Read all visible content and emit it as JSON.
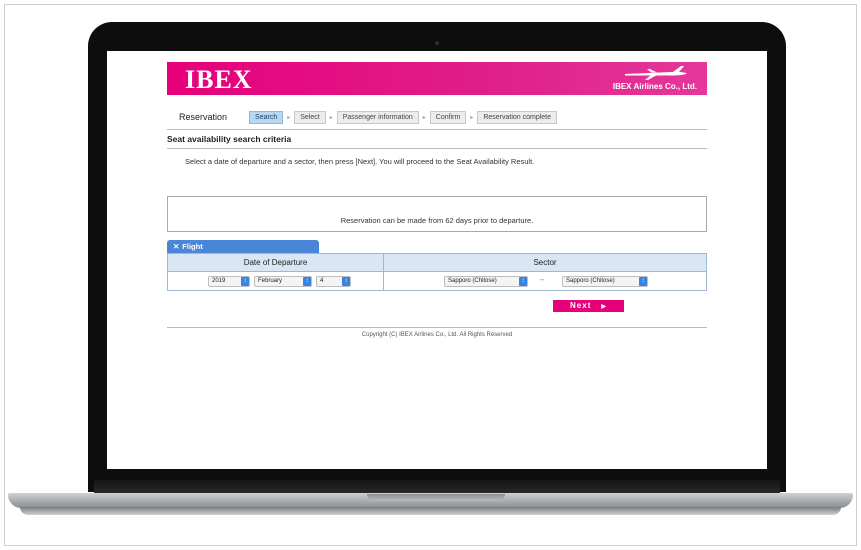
{
  "brand": {
    "logo": "IBEX",
    "company": "IBEX Airlines Co., Ltd.",
    "banner_color": "#e6007a"
  },
  "steps": {
    "label": "Reservation",
    "items": [
      {
        "label": "Search",
        "active": true
      },
      {
        "label": "Select",
        "active": false
      },
      {
        "label": "Passenger information",
        "active": false
      },
      {
        "label": "Confirm",
        "active": false
      },
      {
        "label": "Reservation complete",
        "active": false
      }
    ],
    "separator": "▸"
  },
  "section": {
    "title": "Seat availability search criteria",
    "instruction": "Select a date of departure and a sector, then press [Next]. You will proceed to the Seat Availability Result."
  },
  "notice": {
    "text": "Reservation can be made from 62 days prior to departure."
  },
  "flight": {
    "tab_label": "Flight",
    "tab_icon": "✕",
    "headers": {
      "date": "Date of Departure",
      "sector": "Sector"
    },
    "date": {
      "year": "2019",
      "month": "February",
      "day": "4"
    },
    "sector": {
      "from": "Sapporo (Chitose)",
      "to": "Sapporo (Chitose)",
      "arrow": "→"
    }
  },
  "actions": {
    "next_label": "Next",
    "next_icon": "▶"
  },
  "footer": {
    "copyright": "Copyright (C) IBEX Airlines Co., Ltd. All Rights Reserved"
  },
  "icons": {
    "select_arrow": "↕"
  }
}
